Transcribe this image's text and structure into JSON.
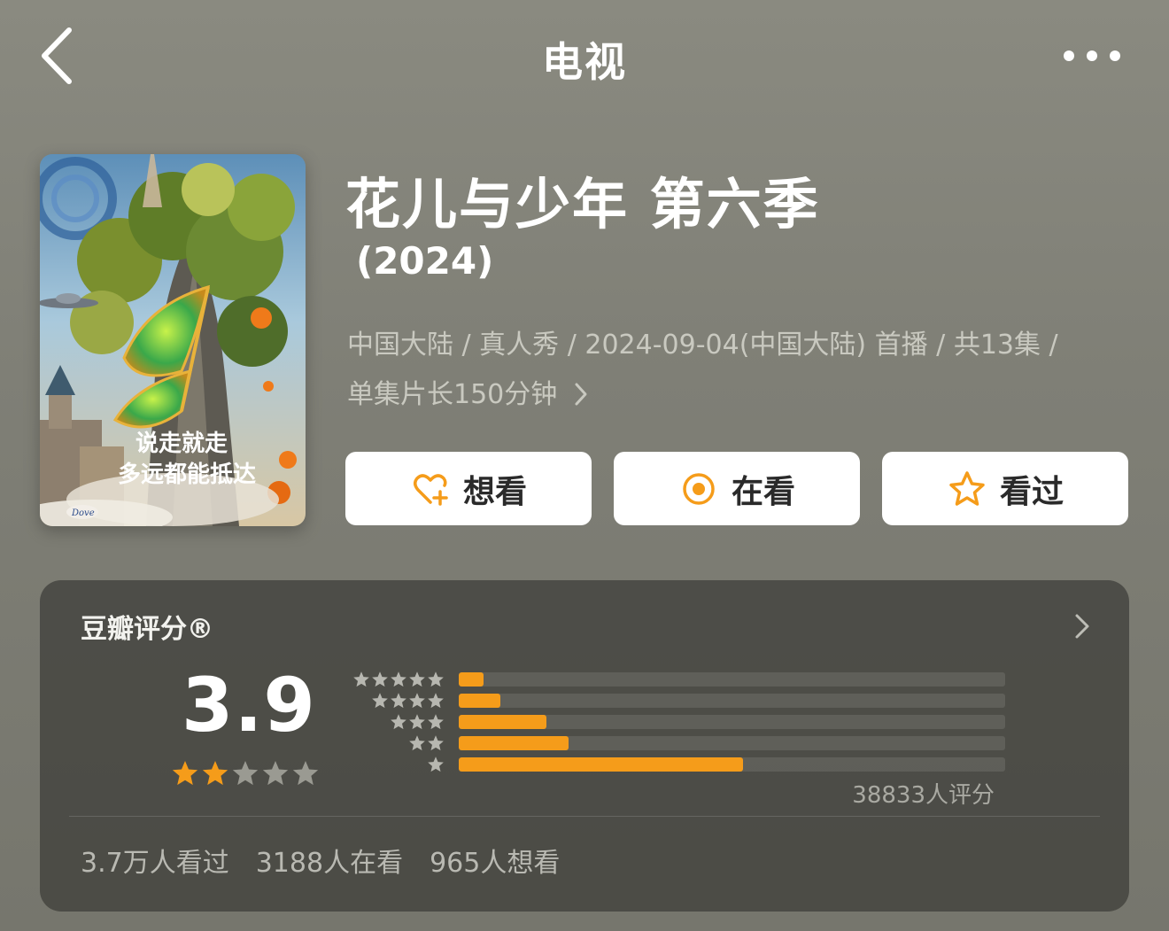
{
  "header": {
    "title": "电视",
    "back_icon": "chevron-left-icon",
    "more_icon": "more-horizontal-icon"
  },
  "show": {
    "title": "花儿与少年 第六季",
    "year": "(2024)",
    "meta_line1": "中国大陆 / 真人秀 / 2024-09-04(中国大陆) 首播 / 共13集 /",
    "meta_line2": "单集片长150分钟",
    "poster_text_line1": "说走就走",
    "poster_text_line2": "多远都能抵达",
    "poster_badge": "Dove"
  },
  "actions": [
    {
      "label": "想看",
      "icon": "heart-plus-icon"
    },
    {
      "label": "在看",
      "icon": "target-circle-icon"
    },
    {
      "label": "看过",
      "icon": "star-outline-icon"
    }
  ],
  "rating": {
    "title": "豆瓣评分®",
    "score": "3.9",
    "stars_filled": 2,
    "stars_total": 5,
    "count_text": "38833人评分",
    "distribution": [
      {
        "stars": 5,
        "fraction": 0.045
      },
      {
        "stars": 4,
        "fraction": 0.075
      },
      {
        "stars": 3,
        "fraction": 0.16
      },
      {
        "stars": 2,
        "fraction": 0.2
      },
      {
        "stars": 1,
        "fraction": 0.52
      }
    ]
  },
  "stats": {
    "watched": "3.7万人看过",
    "watching": "3188人在看",
    "want": "965人想看"
  },
  "colors": {
    "accent": "#f59c1a",
    "background": "#83837a",
    "card": "#4d4d47"
  }
}
